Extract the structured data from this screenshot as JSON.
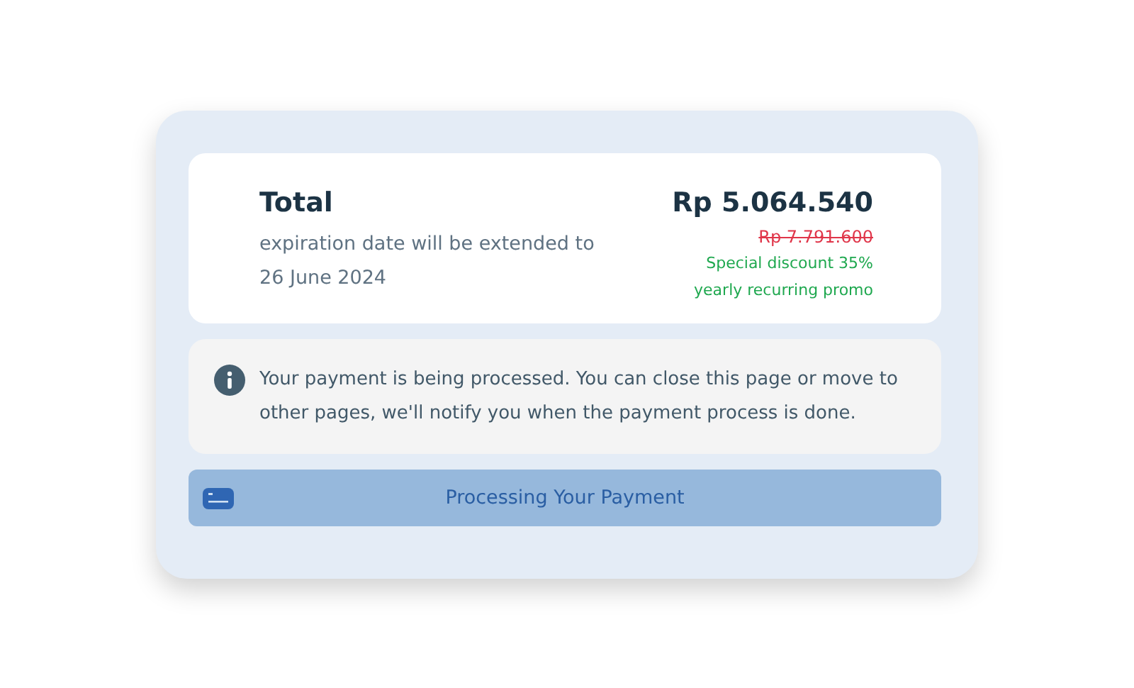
{
  "total": {
    "title": "Total",
    "note": "expiration date will be extended to 26 June 2024",
    "price": "Rp 5.064.540",
    "original_price": "Rp 7.791.600",
    "discount": "Special discount 35%",
    "promo": "yearly recurring promo"
  },
  "info": {
    "message": "Your payment is being processed. You can close this page or move to other pages, we'll notify you when the payment process is done."
  },
  "button": {
    "label": "Processing Your Payment"
  }
}
